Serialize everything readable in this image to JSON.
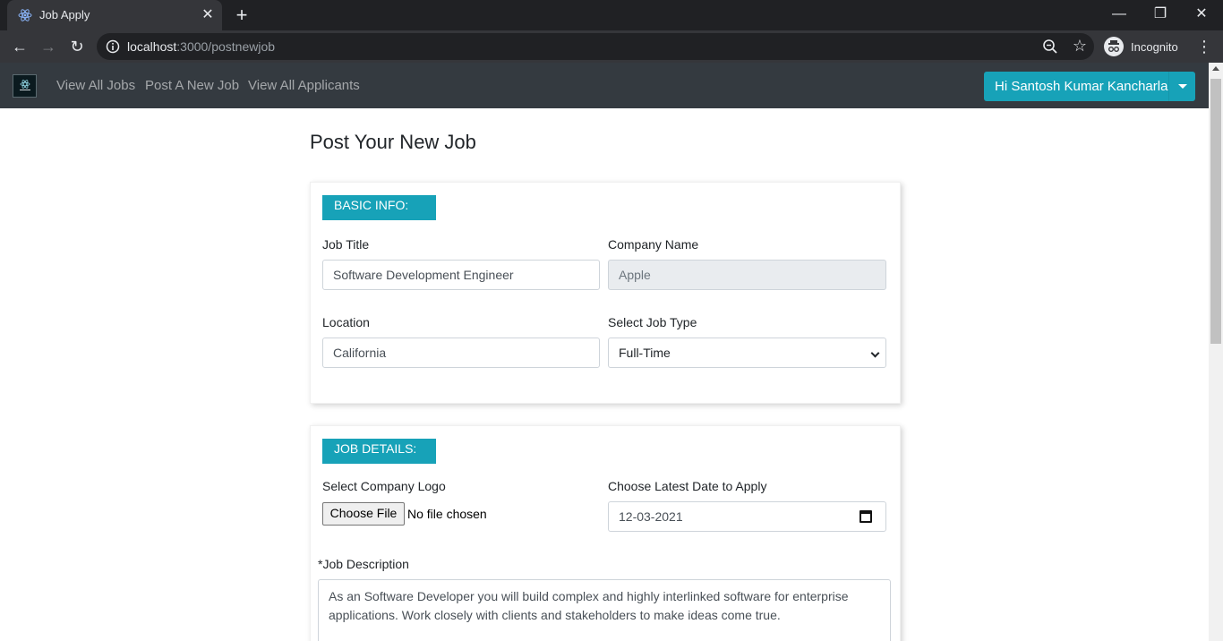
{
  "browser": {
    "tab_title": "Job Apply",
    "url_host": "localhost",
    "url_path": ":3000/postnewjob",
    "profile_label": "Incognito"
  },
  "nav": {
    "links": [
      "View All Jobs",
      "Post A New Job",
      "View All Applicants"
    ],
    "user_button": "Hi Santosh Kumar Kancharla"
  },
  "page": {
    "title": "Post Your New Job"
  },
  "basic_info": {
    "header": "BASIC INFO:",
    "job_title_label": "Job Title",
    "job_title_value": "Software Development Engineer",
    "company_name_label": "Company Name",
    "company_name_value": "Apple",
    "location_label": "Location",
    "location_value": "California",
    "job_type_label": "Select Job Type",
    "job_type_value": "Full-Time"
  },
  "job_details": {
    "header": "JOB DETAILS:",
    "logo_label": "Select Company Logo",
    "file_button": "Choose File",
    "file_status": "No file chosen",
    "date_label": "Choose Latest Date to Apply",
    "date_value": "12-03-2021",
    "description_label": "*Job Description",
    "description_value": "As an Software Developer you will build complex and highly interlinked software for enterprise applications. Work closely with clients and stakeholders to make ideas come true."
  },
  "colors": {
    "accent": "#17a2b8",
    "navbar": "#343a40"
  }
}
